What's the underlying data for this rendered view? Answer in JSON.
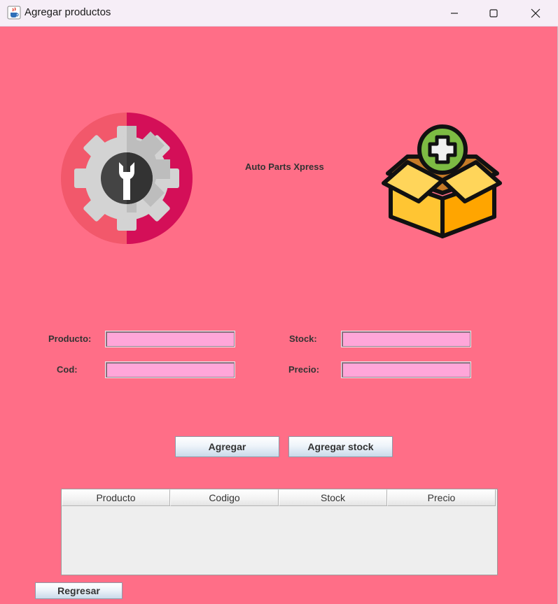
{
  "window": {
    "title": "Agregar productos",
    "controls": [
      "minimize-icon",
      "maximize-icon",
      "close-icon"
    ]
  },
  "app": {
    "icon": "java-cup-icon",
    "heading": "Auto Parts Xpress",
    "logos": [
      "gear-wrench-logo",
      "box-add-logo"
    ]
  },
  "form": {
    "producto_label": "Producto:",
    "producto_value": "",
    "cod_label": "Cod:",
    "cod_value": "",
    "stock_label": "Stock:",
    "stock_value": "",
    "precio_label": "Precio:",
    "precio_value": ""
  },
  "buttons": {
    "agregar": "Agregar",
    "agregar_stock": "Agregar stock",
    "regresar": "Regresar"
  },
  "table": {
    "columns": [
      "Producto",
      "Codigo",
      "Stock",
      "Precio"
    ],
    "rows": []
  },
  "colors": {
    "background": "#ff6e87",
    "field": "#ffa6d9",
    "table": "#eeeeee"
  }
}
